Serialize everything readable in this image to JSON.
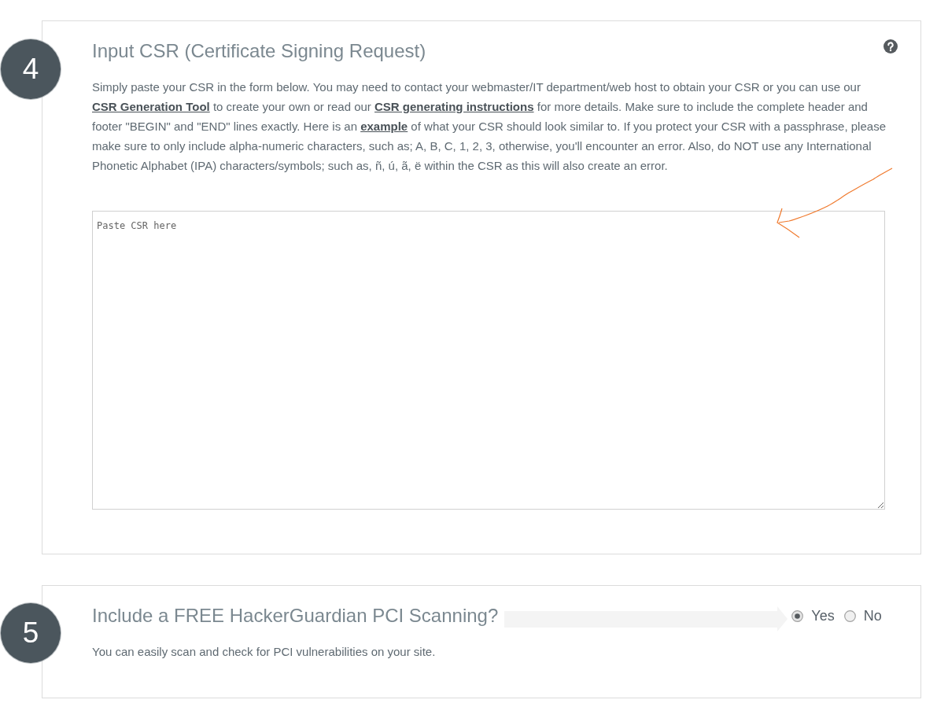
{
  "csr_step": {
    "number": "4",
    "title": "Input CSR (Certificate Signing Request)",
    "description": [
      {
        "kind": "text",
        "text": "Simply paste your CSR in the form below. You may need to contact your webmaster/IT department/web host to obtain your CSR or you can use our "
      },
      {
        "kind": "link",
        "text": "CSR Generation Tool"
      },
      {
        "kind": "text",
        "text": " to create your own or read our "
      },
      {
        "kind": "link",
        "text": "CSR generating instructions"
      },
      {
        "kind": "text",
        "text": " for more details. Make sure to include the complete header and footer \"BEGIN\" and \"END\" lines exactly. Here is an "
      },
      {
        "kind": "link",
        "text": "example"
      },
      {
        "kind": "text",
        "text": " of what your CSR should look similar to. If you protect your CSR with a passphrase, please make sure to only include alpha-numeric characters, such as; A, B, C, 1, 2, 3, otherwise, you'll encounter an error. Also, do NOT use any International Phonetic Alphabet (IPA) characters/symbols; such as, ñ, ú, ã, ë within the CSR as this will also create an error."
      }
    ],
    "textarea": {
      "placeholder": "Paste CSR here"
    }
  },
  "scan_step": {
    "number": "5",
    "title": "Include a FREE HackerGuardian PCI Scanning?",
    "options": [
      {
        "label": "Yes",
        "selected": true
      },
      {
        "label": "No",
        "selected": false
      }
    ],
    "description": "You can easily scan and check for PCI vulnerabilities on your site."
  }
}
